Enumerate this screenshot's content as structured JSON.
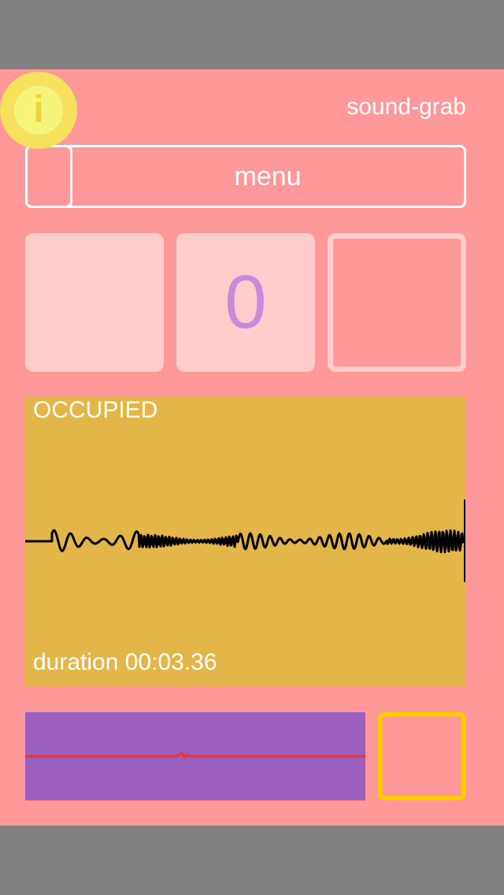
{
  "app": {
    "title": "sound-grab"
  },
  "info_button": {
    "icon": "info-icon",
    "glyph": "i"
  },
  "menu": {
    "label": "menu"
  },
  "tiles": {
    "counter_value": "0"
  },
  "waveform": {
    "status": "OCCUPIED",
    "duration": "duration 00:03.36"
  },
  "colors": {
    "background": "#ff9999",
    "info_outer": "#f5e15c",
    "info_inner": "#f5f57e",
    "tile_fill": "#ffcccc",
    "counter_text": "#cc88dd",
    "waveform_panel": "#e4b548",
    "scope_panel": "#9b5fc0",
    "scope_trace": "#ee3333",
    "record_border": "#ffcc00"
  }
}
